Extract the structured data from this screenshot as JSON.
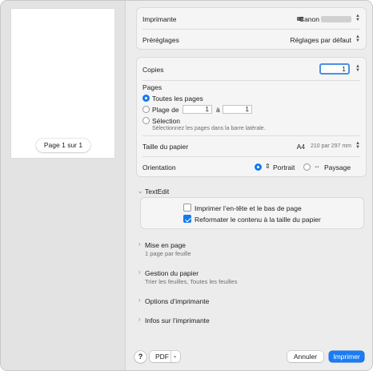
{
  "preview": {
    "page_indicator": "Page 1 sur 1"
  },
  "printer": {
    "label": "Imprimante",
    "value": "Canon",
    "icon": "printer-icon"
  },
  "presets": {
    "label": "Préréglages",
    "value": "Réglages par défaut"
  },
  "copies": {
    "label": "Copies",
    "value": "1"
  },
  "pages": {
    "label": "Pages",
    "all_label": "Toutes les pages",
    "range_label": "Plage de",
    "range_from": "1",
    "range_to_label": "à",
    "range_to": "1",
    "selection_label": "Sélection",
    "selection_hint": "Sélectionnez les pages dans la barre latérale.",
    "selected": "all"
  },
  "paper_size": {
    "label": "Taille du papier",
    "value": "A4",
    "detail": "210 par 297 mm"
  },
  "orientation": {
    "label": "Orientation",
    "portrait_label": "Portrait",
    "landscape_label": "Paysage",
    "selected": "portrait"
  },
  "textedit": {
    "title": "TextEdit",
    "header_footer_label": "Imprimer l’en-tête et le bas de page",
    "header_footer_checked": false,
    "rewrap_label": "Reformater le contenu à la taille du papier",
    "rewrap_checked": true
  },
  "sections": [
    {
      "title": "Mise en page",
      "subtitle": "1 page par feuille"
    },
    {
      "title": "Gestion du papier",
      "subtitle": "Trier les feuilles, Toutes les feuilles"
    },
    {
      "title": "Options d’imprimante",
      "subtitle": ""
    },
    {
      "title": "Infos sur l’imprimante",
      "subtitle": ""
    }
  ],
  "footer": {
    "help_label": "?",
    "pdf_label": "PDF",
    "cancel_label": "Annuler",
    "print_label": "Imprimer"
  },
  "colors": {
    "accent": "#1479f5",
    "primary_button": "#1a7cf5"
  }
}
